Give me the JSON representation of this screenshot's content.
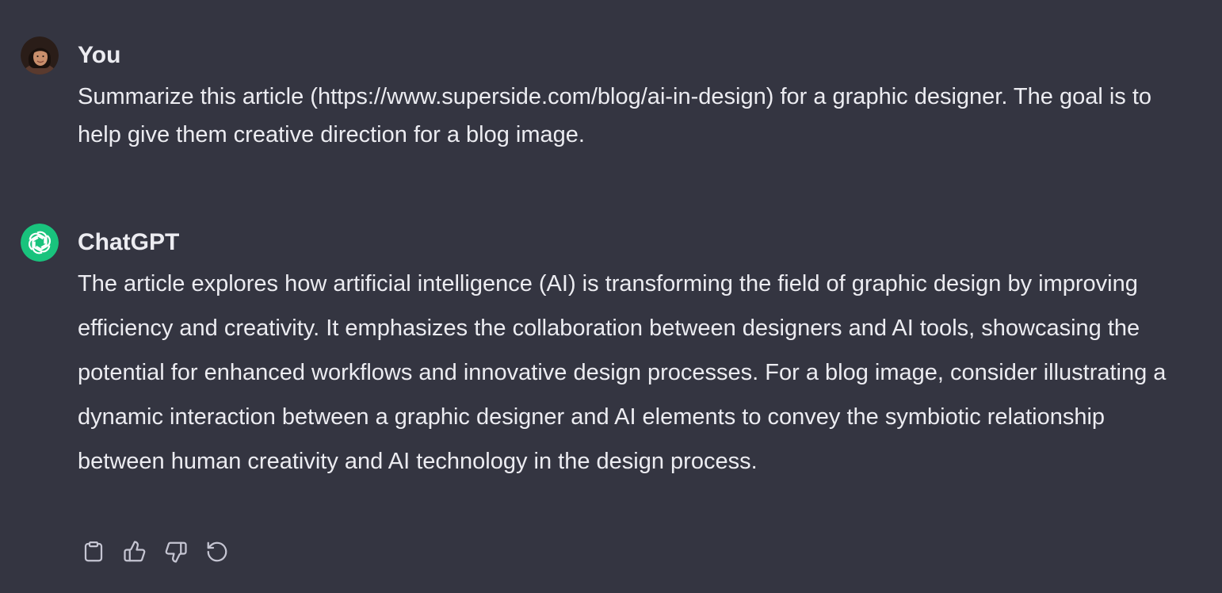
{
  "messages": [
    {
      "role": "user",
      "author": "You",
      "avatar_icon": "user-avatar-photo",
      "text": "Summarize this article (https://www.superside.com/blog/ai-in-design) for a graphic designer. The goal is to help give them creative direction for a blog image."
    },
    {
      "role": "assistant",
      "author": "ChatGPT",
      "avatar_icon": "openai-logo-icon",
      "avatar_color": "#19c37d",
      "text": "The article explores how artificial intelligence (AI) is transforming the field of graphic design by improving efficiency and creativity. It emphasizes the collaboration between designers and AI tools, showcasing the potential for enhanced workflows and innovative design processes. For a blog image, consider illustrating a dynamic interaction between a graphic designer and AI elements to convey the symbiotic relationship between human creativity and AI technology in the design process."
    }
  ],
  "actions": [
    {
      "icon": "clipboard-icon"
    },
    {
      "icon": "thumbs-up-icon"
    },
    {
      "icon": "thumbs-down-icon"
    },
    {
      "icon": "regenerate-icon"
    }
  ],
  "theme": {
    "background": "#343541",
    "text": "#ececf1",
    "icon": "#c5c5d2",
    "accent": "#19c37d"
  }
}
